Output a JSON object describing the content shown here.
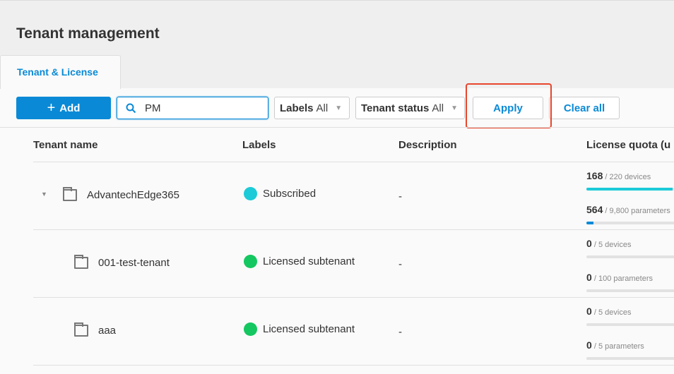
{
  "page": {
    "title": "Tenant management",
    "tab": "Tenant & License"
  },
  "toolbar": {
    "add_label": "Add",
    "search_value": "PM",
    "labels_filter": {
      "label": "Labels",
      "value": "All"
    },
    "status_filter": {
      "label": "Tenant status",
      "value": "All"
    },
    "apply_label": "Apply",
    "clear_label": "Clear all"
  },
  "colors": {
    "accent": "#0a8ad6",
    "highlight": "#e8452c",
    "subscribed": "#1ccad8",
    "licensed": "#14c760"
  },
  "table": {
    "columns": [
      "Tenant name",
      "Labels",
      "Description",
      "License quota (u"
    ],
    "rows": [
      {
        "name": "AdvantechEdge365",
        "label": "Subscribed",
        "description": "-",
        "devices_used": "168",
        "devices_total": "/ 220 devices",
        "devices_pct": 76,
        "params_used": "564",
        "params_total": "/ 9,800 parameters",
        "params_pct": 6
      },
      {
        "name": "001-test-tenant",
        "label": "Licensed subtenant",
        "description": "-",
        "devices_used": "0",
        "devices_total": "/ 5 devices",
        "devices_pct": 0,
        "params_used": "0",
        "params_total": "/ 100 parameters",
        "params_pct": 0
      },
      {
        "name": "aaa",
        "label": "Licensed subtenant",
        "description": "-",
        "devices_used": "0",
        "devices_total": "/ 5 devices",
        "devices_pct": 0,
        "params_used": "0",
        "params_total": "/ 5 parameters",
        "params_pct": 0
      }
    ]
  }
}
